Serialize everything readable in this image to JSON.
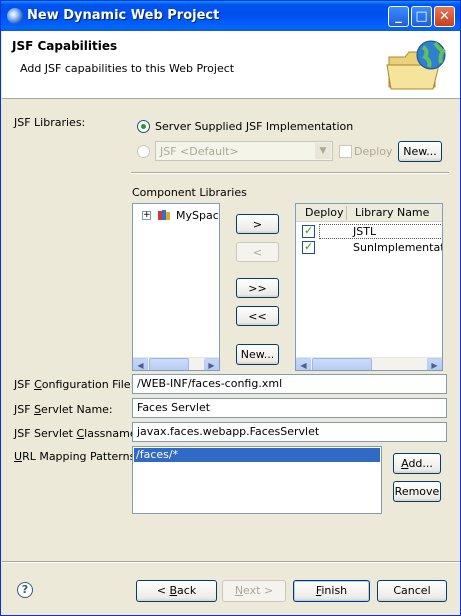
{
  "window": {
    "title": "New Dynamic Web Project",
    "controls": {
      "minimize": "_",
      "maximize": "□",
      "close": "✕"
    }
  },
  "header": {
    "title": "JSF Capabilities",
    "description": "Add JSF capabilities to this Web Project"
  },
  "jsf_libraries": {
    "label": "JSF Libraries:",
    "option_server": "Server Supplied JSF Implementation",
    "option_server_selected": true,
    "option_custom_selected": false,
    "combo_value": "JSF <Default>",
    "deploy_label": "Deploy",
    "new_button": "New..."
  },
  "component_libraries": {
    "label": "Component Libraries",
    "tree_item": "MySpace",
    "buttons": {
      "add": ">",
      "remove": "<",
      "add_all": ">>",
      "remove_all": "<<",
      "new": "New..."
    },
    "table": {
      "columns": [
        "Deploy",
        "Library Name"
      ],
      "rows": [
        {
          "deploy": true,
          "name": "JSTL"
        },
        {
          "deploy": true,
          "name": "SunImplementation"
        }
      ]
    }
  },
  "config": {
    "config_file_label": "JSF Configuration File:",
    "config_file_value": "/WEB-INF/faces-config.xml",
    "servlet_name_label": "JSF Servlet Name:",
    "servlet_name_value": "Faces Servlet",
    "servlet_class_label": "JSF Servlet Classname:",
    "servlet_class_value": "javax.faces.webapp.FacesServlet",
    "url_mapping_label": "URL Mapping Patterns:",
    "url_patterns": [
      "/faces/*"
    ],
    "add_button": "Add...",
    "remove_button": "Remove"
  },
  "footer": {
    "help": "?",
    "back": "< Back",
    "next": "Next >",
    "finish": "Finish",
    "cancel": "Cancel"
  },
  "colors": {
    "title_bar": "#0054e3",
    "selection": "#316ac5",
    "dialog_bg": "#ece9d8"
  }
}
